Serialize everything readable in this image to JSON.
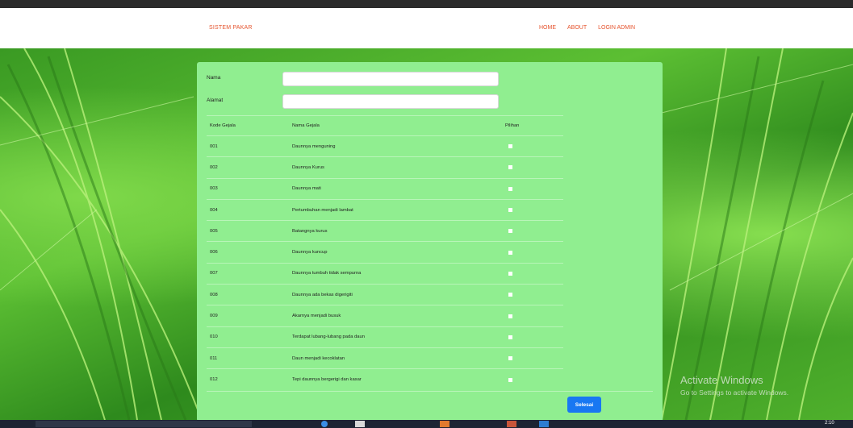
{
  "navbar": {
    "brand": "SISTEM PAKAR",
    "links": [
      "HOME",
      "ABOUT",
      "LOGIN ADMIN"
    ]
  },
  "form": {
    "nama_label": "Nama",
    "nama_value": "",
    "alamat_label": "Alamat",
    "alamat_value": ""
  },
  "table": {
    "headers": [
      "Kode Gejala",
      "Nama Gejala",
      "Pilihan"
    ],
    "rows": [
      {
        "kode": "001",
        "nama": "Daunnya menguning"
      },
      {
        "kode": "002",
        "nama": "Daunnya Kurus"
      },
      {
        "kode": "003",
        "nama": "Daunnya mati"
      },
      {
        "kode": "004",
        "nama": "Pertumbuhan menjadi lambat"
      },
      {
        "kode": "005",
        "nama": "Batangnya kurus"
      },
      {
        "kode": "006",
        "nama": "Daunnya kuncup"
      },
      {
        "kode": "007",
        "nama": "Daunnya tumbuh tidak sempurna"
      },
      {
        "kode": "008",
        "nama": "Daunnya ada bekas digerigiti"
      },
      {
        "kode": "009",
        "nama": "Akarnya menjadi busuk"
      },
      {
        "kode": "010",
        "nama": "Terdapat lubang-lubang pada daun"
      },
      {
        "kode": "011",
        "nama": "Daun menjadi kecoklatan"
      },
      {
        "kode": "012",
        "nama": "Tepi daunnya bergerigi dan kasar"
      }
    ]
  },
  "submit_label": "Selesai",
  "watermark": {
    "line1": "Activate Windows",
    "line2": "Go to Settings to activate Windows."
  },
  "taskbar": {
    "time": "2:10"
  },
  "colors": {
    "accent": "#e5532d",
    "panel": "#90ee90",
    "button": "#1877f2"
  }
}
